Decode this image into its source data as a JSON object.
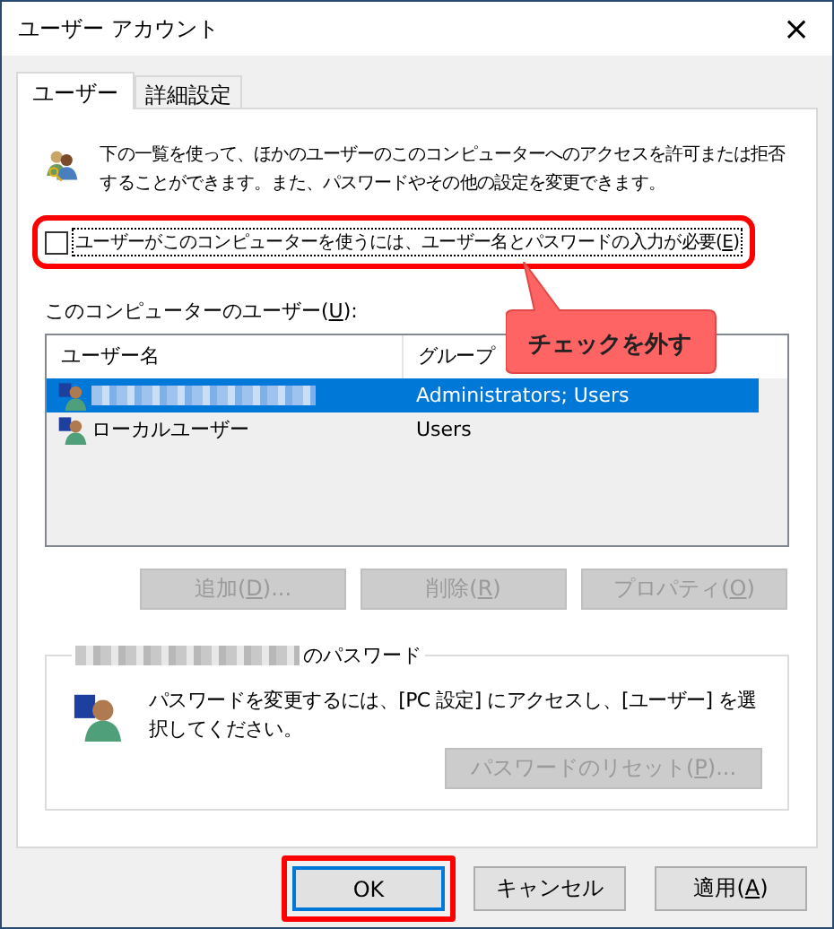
{
  "window": {
    "title": "ユーザー アカウント",
    "close": "×"
  },
  "tabs": [
    {
      "label": "ユーザー",
      "selected": true
    },
    {
      "label": "詳細設定",
      "selected": false
    }
  ],
  "intro": "下の一覧を使って、ほかのユーザーのこのコンピューターへのアクセスを許可または拒否することができます。また、パスワードやその他の設定を変更できます。",
  "require_login": {
    "label": "ユーザーがこのコンピューターを使うには、ユーザー名とパスワードの入力が必要(",
    "key": "E",
    "rest": ")",
    "checked": false,
    "highlighted": true
  },
  "callout": {
    "text": "チェックを外す"
  },
  "users_label": {
    "label": "このコンピューターのユーザー(",
    "key": "U",
    "rest": "):"
  },
  "users_table": {
    "columns": [
      "ユーザー名",
      "グループ"
    ],
    "rows": [
      {
        "kind": "redacted",
        "group": "Administrators; Users",
        "selected": true
      },
      {
        "kind": "text",
        "name": "ローカルユーザー",
        "group": "Users",
        "selected": false
      }
    ]
  },
  "user_buttons": [
    {
      "label": "追加(",
      "key": "D",
      "rest": ")...",
      "disabled": true
    },
    {
      "label": "削除(",
      "key": "R",
      "rest": ")",
      "disabled": true
    },
    {
      "label": "プロパティ(",
      "key": "O",
      "rest": ")",
      "disabled": true
    }
  ],
  "password_group": {
    "owner": {
      "kind": "redacted"
    },
    "title": "のパスワード",
    "message": "パスワードを変更するには、[PC 設定] にアクセスし、[ユーザー] を選択してください。",
    "reset_button": {
      "label": "パスワードのリセット(",
      "key": "P",
      "rest": ")...",
      "disabled": true
    }
  },
  "dialog_buttons": [
    {
      "label": "OK",
      "default": true,
      "highlighted": true
    },
    {
      "label": "キャンセル",
      "default": false,
      "highlighted": false
    },
    {
      "label": "適用(",
      "key": "A",
      "rest": ")",
      "default": false,
      "highlighted": false
    }
  ]
}
